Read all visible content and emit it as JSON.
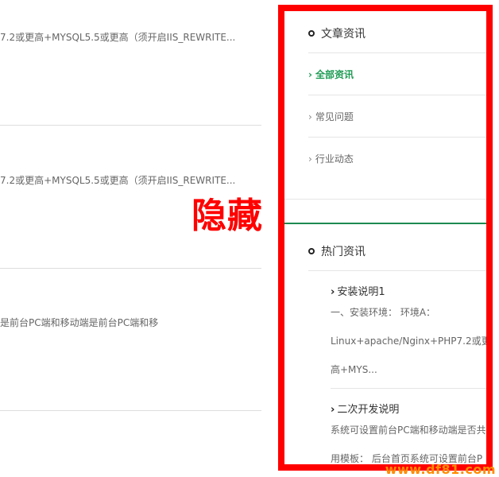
{
  "left_list": {
    "items": [
      {
        "text": "7.2或更高+MYSQL5.5或更高（须开启IIS_REWRITE..."
      },
      {
        "text": "7.2或更高+MYSQL5.5或更高（须开启IIS_REWRITE..."
      },
      {
        "text": "是前台PC端和移动端是前台PC端和移"
      }
    ]
  },
  "overlay": {
    "hidden_label": "隐藏"
  },
  "sidebar": {
    "news_section": {
      "title": "文章资讯",
      "categories": [
        {
          "label": "全部资讯",
          "active": true
        },
        {
          "label": "常见问题",
          "active": false
        },
        {
          "label": "行业动态",
          "active": false
        }
      ]
    },
    "hot_section": {
      "title": "热门资讯",
      "items": [
        {
          "title": "安装说明1",
          "lines": [
            "一、安装环境： 环境A：",
            "Linux+apache/Nginx+PHP7.2或更",
            "高+MYS..."
          ]
        },
        {
          "title": "二次开发说明",
          "lines": [
            "系统可设置前台PC端和移动端是否共",
            "用模板： 后台首页系统可设置前台P"
          ]
        }
      ]
    }
  },
  "watermark": "www.df81.com",
  "colors": {
    "accent_green": "#1e9b54",
    "frame_red": "#ff0000",
    "watermark_orange": "#ff8c00"
  }
}
